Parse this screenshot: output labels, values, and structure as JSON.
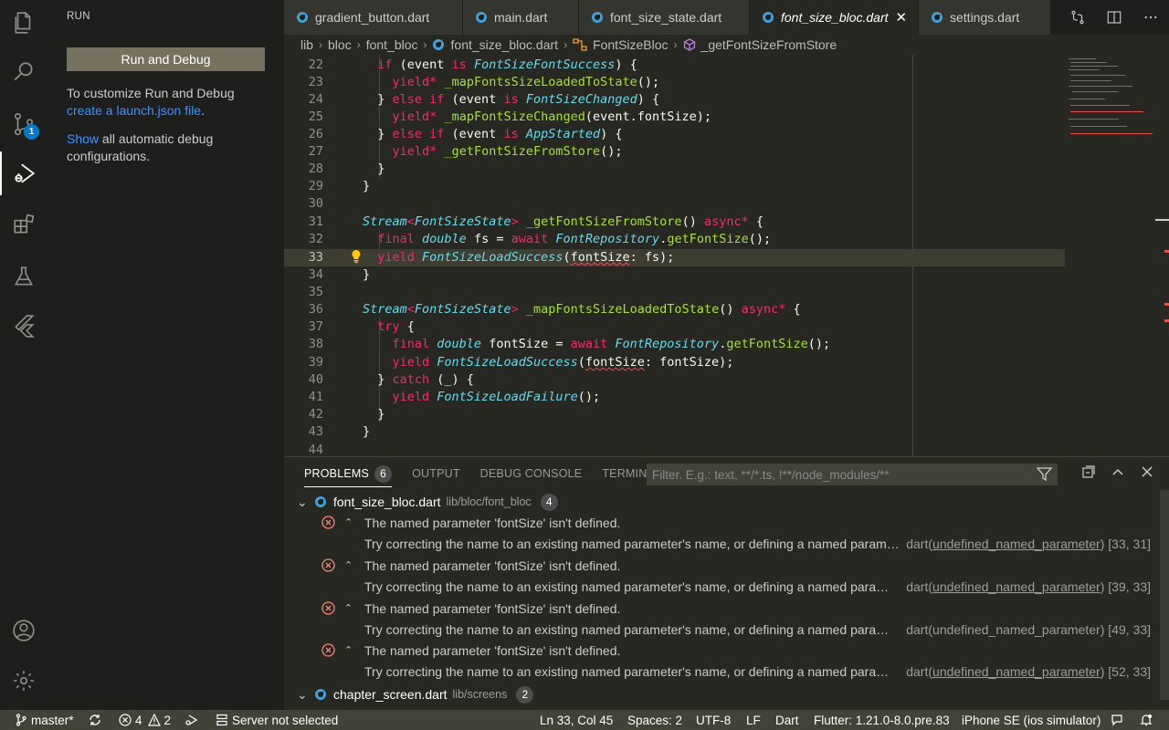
{
  "sidebar": {
    "title": "RUN",
    "run_button": "Run and Debug",
    "customize_text": "To customize Run and Debug",
    "create_link": "create a launch.json file",
    "period": ".",
    "show_link": "Show",
    "show_text": "all automatic debug configurations."
  },
  "activity": {
    "scm_badge": "1"
  },
  "tabs": [
    {
      "label": "gradient_button.dart"
    },
    {
      "label": "main.dart"
    },
    {
      "label": "font_size_state.dart"
    },
    {
      "label": "font_size_bloc.dart",
      "close": "✕"
    },
    {
      "label": "settings.dart"
    }
  ],
  "breadcrumbs": [
    "lib",
    "bloc",
    "font_bloc",
    "font_size_bloc.dart",
    "FontSizeBloc",
    "_getFontSizeFromStore"
  ],
  "editor": {
    "lines": [
      "22",
      "23",
      "24",
      "25",
      "26",
      "27",
      "28",
      "29",
      "30",
      "31",
      "32",
      "33",
      "34",
      "35",
      "36",
      "37",
      "38",
      "39",
      "40",
      "41",
      "42",
      "43",
      "44"
    ]
  },
  "panel": {
    "tabs": [
      "PROBLEMS",
      "OUTPUT",
      "DEBUG CONSOLE",
      "TERMINAL"
    ],
    "problems_count": "6",
    "filter_placeholder": "Filter. E.g.: text, **/*.ts, !**/node_modules/**",
    "files": [
      {
        "name": "font_size_bloc.dart",
        "path": "lib/bloc/font_bloc",
        "count": "4"
      },
      {
        "name": "chapter_screen.dart",
        "path": "lib/screens",
        "count": "2"
      }
    ],
    "problems": [
      {
        "msg": "The named parameter 'fontSize' isn't defined.",
        "detail": "Try correcting the name to an existing named parameter's name, or defining a named parameter with the name 'fontSize'.",
        "src_prefix": "dart(",
        "code": "undefined_named_parameter",
        "src_suffix": ")",
        "pos": "[33, 31]"
      },
      {
        "msg": "The named parameter 'fontSize' isn't defined.",
        "detail": "Try correcting the name to an existing named parameter's name, or defining a named parameter with the name 'fontSize'.",
        "src_prefix": "dart(",
        "code": "undefined_named_parameter",
        "src_suffix": ")",
        "pos": "[39, 33]"
      },
      {
        "msg": "The named parameter 'fontSize' isn't defined.",
        "detail": "Try correcting the name to an existing named parameter's name, or defining a named parameter with the name 'fontSize'.",
        "src_prefix": "dart(",
        "code": "undefined_named_parameter",
        "src_suffix": ")",
        "pos": "[49, 33]"
      },
      {
        "msg": "The named parameter 'fontSize' isn't defined.",
        "detail": "Try correcting the name to an existing named parameter's name, or defining a named parameter with the name 'fontSize'.",
        "src_prefix": "dart(",
        "code": "undefined_named_parameter",
        "src_suffix": ")",
        "pos": "[52, 33]"
      }
    ]
  },
  "status": {
    "branch": "master*",
    "errors": "4",
    "warnings": "2",
    "server": "Server not selected",
    "position": "Ln 33, Col 45",
    "spaces": "Spaces: 2",
    "encoding": "UTF-8",
    "eol": "LF",
    "language": "Dart",
    "flutter": "Flutter: 1.21.0-8.0.pre.83",
    "device": "iPhone SE (ios simulator)"
  },
  "colors": {
    "accent": "#007acc",
    "error": "#f14c4c",
    "statusbar": "#414339"
  }
}
